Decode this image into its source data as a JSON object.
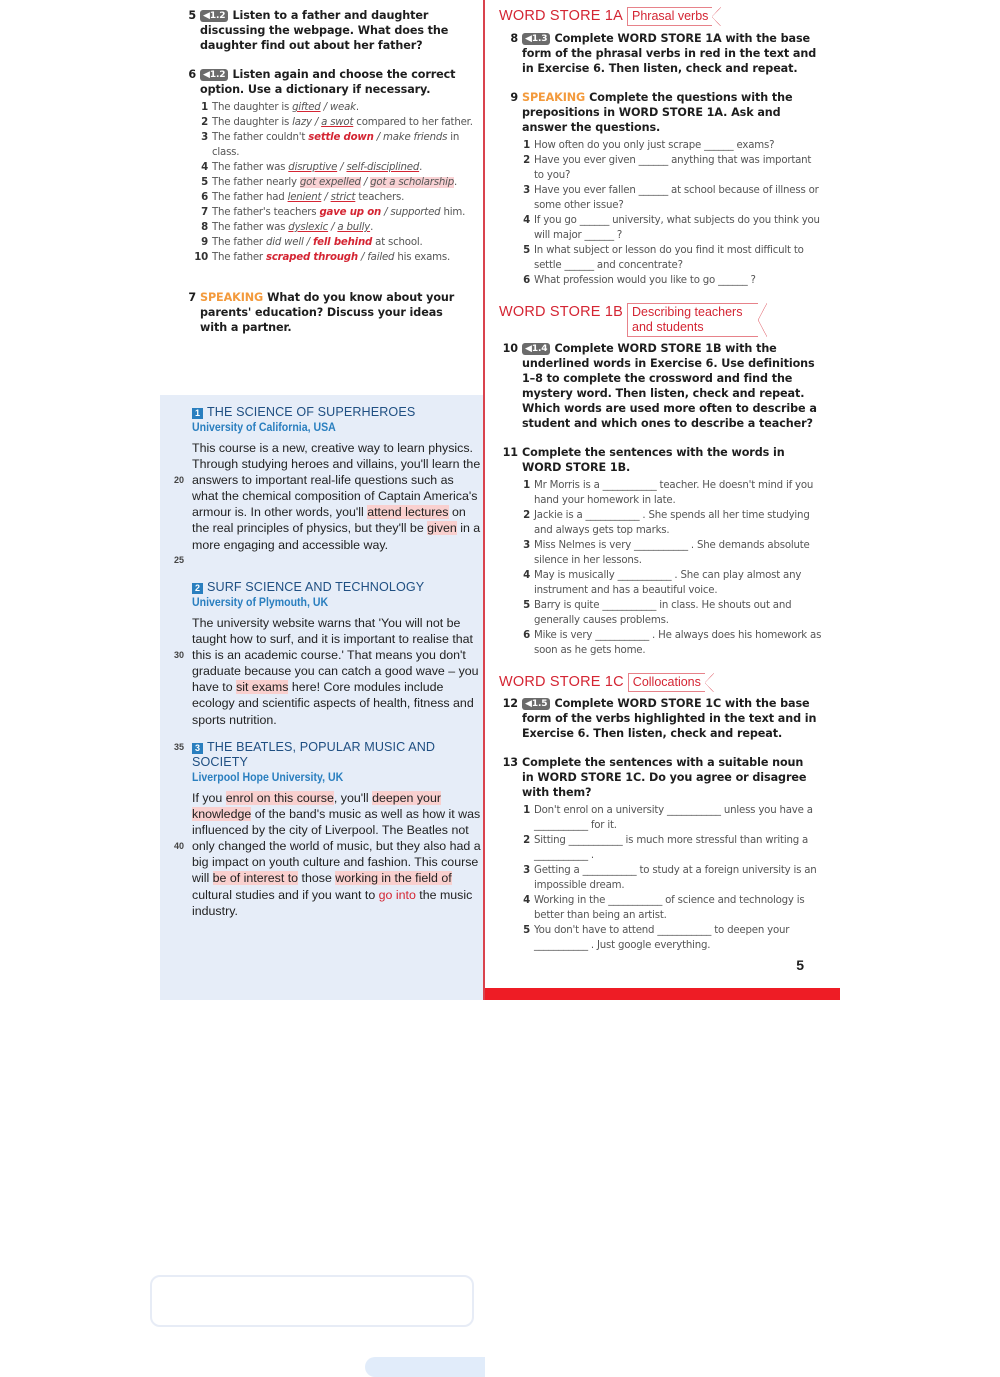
{
  "page_number": "5",
  "left": {
    "ex5": {
      "num": "5",
      "audio": "◀1.2",
      "text": "Listen to a father and daughter discussing the webpage. What does the daughter find out about her father?"
    },
    "ex6": {
      "num": "6",
      "audio": "◀1.2",
      "text": "Listen again and choose the correct option. Use a dictionary if necessary.",
      "items": [
        {
          "n": "1",
          "pre": "The daughter is ",
          "a": "gifted",
          "sep": " / ",
          "b": "weak",
          "post": "."
        },
        {
          "n": "2",
          "pre": "The daughter is ",
          "a": "lazy",
          "sep": " / ",
          "b": "a swot",
          "post": " compared to her father."
        },
        {
          "n": "3",
          "pre": "The father couldn't ",
          "a": "settle down",
          "sep": " / ",
          "b": "make friends",
          "post": " in class."
        },
        {
          "n": "4",
          "pre": "The father was ",
          "a": "disruptive",
          "sep": " / ",
          "b": "self-disciplined",
          "post": "."
        },
        {
          "n": "5",
          "pre": "The father nearly ",
          "a": "got expelled",
          "sep": " / ",
          "b": "got a scholarship",
          "post": "."
        },
        {
          "n": "6",
          "pre": "The father had ",
          "a": "lenient",
          "sep": " / ",
          "b": "strict",
          "post": " teachers."
        },
        {
          "n": "7",
          "pre": "The father's teachers ",
          "a": "gave up on",
          "sep": " / ",
          "b": "supported",
          "post": " him."
        },
        {
          "n": "8",
          "pre": "The father was ",
          "a": "dyslexic",
          "sep": " / ",
          "b": "a bully",
          "post": "."
        },
        {
          "n": "9",
          "pre": "The father ",
          "a": "did well",
          "sep": " / ",
          "b": "fell behind",
          "post": " at school."
        },
        {
          "n": "10",
          "pre": "The father ",
          "a": "scraped through",
          "sep": " / ",
          "b": "failed",
          "post": " his exams."
        }
      ]
    },
    "ex7": {
      "num": "7",
      "speaking": "SPEAKING",
      "text": "What do you know about your parents' education? Discuss your ideas with a partner."
    },
    "articles": [
      {
        "badge": "1",
        "title": "THE SCIENCE OF SUPERHEROES",
        "sub": "University of California, USA",
        "p1": "This course is a new, creative way to learn physics. Through studying heroes and villains, you'll learn the answers to important real-life questions such as what the chemical composition of Captain America's armour is. In other words, you'll ",
        "h1": "attend lectures",
        "p2": " on the real principles of physics, but they'll be ",
        "h2": "given",
        "p3": " in a more engaging and accessible way.",
        "line_numbers": [
          "20",
          "25"
        ]
      },
      {
        "badge": "2",
        "title": "SURF SCIENCE AND TECHNOLOGY",
        "sub": "University of Plymouth, UK",
        "p1": "The university website warns that 'You will not be taught how to surf, and it is important to realise that this is an academic course.' That means you don't graduate because you can catch a good wave – you have to ",
        "h1": "sit exams",
        "p2": " here! Core modules include ecology and scientific aspects of health, fitness and sports nutrition.",
        "line_numbers": [
          "30"
        ]
      },
      {
        "badge": "3",
        "title": "THE BEATLES, POPULAR MUSIC AND SOCIETY",
        "sub": "Liverpool Hope University, UK",
        "p1": "If you ",
        "h1": "enrol on this course",
        "p2": ", you'll ",
        "h2": "deepen your knowledge",
        "p3": " of the band's music as well as how it was influenced by the city of Liverpool. The Beatles not only changed the world of music, but they also had a big impact on youth culture and fashion. This course will ",
        "h3": "be of interest to",
        "p4": " those ",
        "h4": "working in the field of",
        "p5": " cultural studies and if you want to ",
        "r1": "go into",
        "p6": " the music industry.",
        "line_numbers": [
          "35",
          "40"
        ]
      }
    ]
  },
  "right": {
    "ws1a": {
      "title": "WORD STORE 1A",
      "tag": "Phrasal verbs"
    },
    "ex8": {
      "num": "8",
      "audio": "◀1.3",
      "text": "Complete WORD STORE 1A with the base form of the phrasal verbs in red in the text and in Exercise 6. Then listen, check and repeat."
    },
    "ex9": {
      "num": "9",
      "speaking": "SPEAKING",
      "text": "Complete the questions with the prepositions in WORD STORE 1A. Ask and answer the questions.",
      "items": [
        {
          "n": "1",
          "t": "How often do you only just scrape ______ exams?"
        },
        {
          "n": "2",
          "t": "Have you ever given ______ anything that was important to you?"
        },
        {
          "n": "3",
          "t": "Have you ever fallen ______ at school because of illness or some other issue?"
        },
        {
          "n": "4",
          "t": "If you go ______ university, what subjects do you think you will major ______ ?"
        },
        {
          "n": "5",
          "t": "In what subject or lesson do you find it most difficult to settle ______ and concentrate?"
        },
        {
          "n": "6",
          "t": "What profession would you like to go ______ ?"
        }
      ]
    },
    "ws1b": {
      "title": "WORD STORE 1B",
      "tag": "Describing teachers and students"
    },
    "ex10": {
      "num": "10",
      "audio": "◀1.4",
      "text": "Complete WORD STORE 1B with the underlined words in Exercise 6. Use definitions 1–8 to complete the crossword and find the mystery word. Then listen, check and repeat. Which words are used more often to describe a student and which ones to describe a teacher?"
    },
    "ex11": {
      "num": "11",
      "text": "Complete the sentences with the words in WORD STORE 1B.",
      "items": [
        {
          "n": "1",
          "t": "Mr Morris is a ___________ teacher. He doesn't mind if you hand your homework in late."
        },
        {
          "n": "2",
          "t": "Jackie is a ___________ . She spends all her time studying and always gets top marks."
        },
        {
          "n": "3",
          "t": "Miss Nelmes is very ___________ . She demands absolute silence in her lessons."
        },
        {
          "n": "4",
          "t": "May is musically ___________ . She can play almost any instrument and has a beautiful voice."
        },
        {
          "n": "5",
          "t": "Barry is quite ___________ in class. He shouts out and generally causes problems."
        },
        {
          "n": "6",
          "t": "Mike is very ___________ . He always does his homework as soon as he gets home."
        }
      ]
    },
    "ws1c": {
      "title": "WORD STORE 1C",
      "tag": "Collocations"
    },
    "ex12": {
      "num": "12",
      "audio": "◀1.5",
      "text": "Complete WORD STORE 1C with the base form of the verbs highlighted in the text and in Exercise 6. Then listen, check and repeat."
    },
    "ex13": {
      "num": "13",
      "text": "Complete the sentences with a suitable noun in WORD STORE 1C. Do you agree or disagree with them?",
      "items": [
        {
          "n": "1",
          "t": "Don't enrol on a university ___________ unless you have a ___________ for it."
        },
        {
          "n": "2",
          "t": "Sitting ___________ is much more stressful than writing a ___________ ."
        },
        {
          "n": "3",
          "t": "Getting a ___________ to study at a foreign university is an impossible dream."
        },
        {
          "n": "4",
          "t": "Working in the ___________ of science and technology is better than being an artist."
        },
        {
          "n": "5",
          "t": "You don't have to attend ___________ to deepen your ___________ . Just google everything."
        }
      ]
    }
  }
}
